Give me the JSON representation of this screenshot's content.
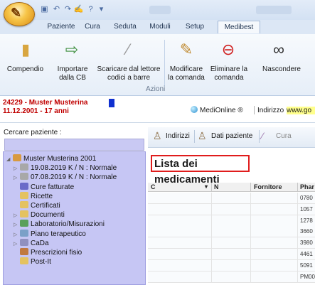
{
  "tabs": [
    "Paziente",
    "Cura",
    "Seduta",
    "Moduli",
    "Setup",
    "Medibest"
  ],
  "ribbon": {
    "buttons": [
      {
        "label": "Compendio",
        "icon": "book-icon"
      },
      {
        "label": "Importare\ndalla CB",
        "icon": "import-icon"
      },
      {
        "label": "Scaricare dal lettore\ncodici a barre",
        "icon": "barcode-reader-icon"
      },
      {
        "label": "Modificare\nla comanda",
        "icon": "edit-order-icon"
      },
      {
        "label": "Eliminare la\ncomanda",
        "icon": "delete-order-icon"
      },
      {
        "label": "Nascondere",
        "icon": "binoculars-icon"
      }
    ],
    "group_label": "Azioni"
  },
  "patient": {
    "line1": "24229 - Muster Musterina",
    "line2": "11.12.2001 - 17 anni"
  },
  "status": {
    "medionline": "MediOnline ®",
    "address_label": "Indirizzo",
    "address_url": "www.go"
  },
  "search": {
    "label": "Cercare paziente :"
  },
  "toolbar": {
    "indirizzi": "Indirizzi",
    "dati_paziente": "Dati paziente",
    "cura": "Cura"
  },
  "tree": [
    {
      "label": "Muster Musterina 2001",
      "level": 0,
      "expander": "◢",
      "icon": "patient-icon"
    },
    {
      "label": "19.08.2019 K / N : Normale",
      "level": 1,
      "expander": "▷",
      "icon": "consultation-icon"
    },
    {
      "label": "07.08.2019 K / N : Normale",
      "level": 1,
      "expander": "▷",
      "icon": "consultation-icon"
    },
    {
      "label": "Cure fatturate",
      "level": 1,
      "expander": "",
      "icon": "invoice-icon"
    },
    {
      "label": "Ricette",
      "level": 1,
      "expander": "",
      "icon": "folder-icon"
    },
    {
      "label": "Certificati",
      "level": 1,
      "expander": "",
      "icon": "folder-icon"
    },
    {
      "label": "Documenti",
      "level": 1,
      "expander": "▷",
      "icon": "folder-icon"
    },
    {
      "label": "Laboratorio/Misurazioni",
      "level": 1,
      "expander": "▷",
      "icon": "lab-icon"
    },
    {
      "label": "Piano terapeutico",
      "level": 1,
      "expander": "▷",
      "icon": "therapy-icon"
    },
    {
      "label": "CaDa",
      "level": 1,
      "expander": "▷",
      "icon": "cada-icon"
    },
    {
      "label": "Prescrizioni fisio",
      "level": 1,
      "expander": "",
      "icon": "physio-icon"
    },
    {
      "label": "Post-It",
      "level": 1,
      "expander": "",
      "icon": "folder-icon"
    }
  ],
  "list": {
    "title": "Lista dei medicamenti",
    "columns": [
      "C",
      "N",
      "Fornitore",
      "Phar"
    ],
    "pharma_codes": [
      "0780",
      "1057",
      "1278",
      "3660",
      "3980",
      "4461",
      "5091",
      "PM00"
    ]
  },
  "colors": {
    "highlight_red": "#e01c1c",
    "tree_bg": "#c6c6f4",
    "patient_red": "#c00000"
  }
}
